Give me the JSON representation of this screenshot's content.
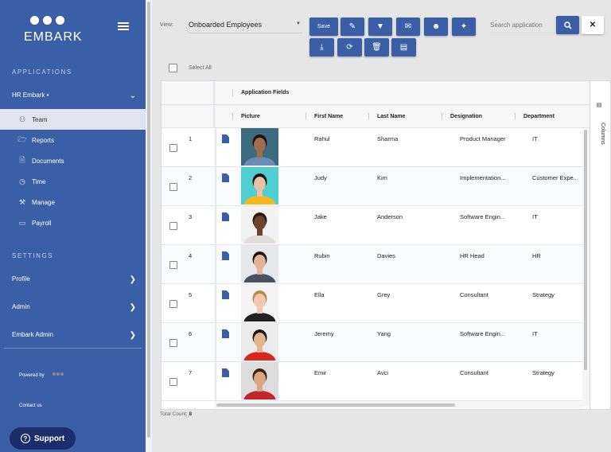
{
  "brand": {
    "name": "EMBARK",
    "menu_icon": "hamburger-icon"
  },
  "sidebar": {
    "applications_title": "APPLICATIONS",
    "app": {
      "label": "HR Embark •",
      "icon": "chevron-down-icon"
    },
    "items": [
      {
        "label": "Team",
        "icon": "team-icon",
        "active": true
      },
      {
        "label": "Reports",
        "icon": "folder-icon"
      },
      {
        "label": "Documents",
        "icon": "document-icon"
      },
      {
        "label": "Time",
        "icon": "clock-icon"
      },
      {
        "label": "Manage",
        "icon": "wrench-icon"
      },
      {
        "label": "Payroll",
        "icon": "card-icon"
      }
    ],
    "settings_title": "SETTINGS",
    "settings": [
      {
        "label": "Profile"
      },
      {
        "label": "Admin"
      },
      {
        "label": "Embark Admin"
      }
    ],
    "powered_by": "Powered by",
    "powered_logo": "EMBARK",
    "contact": "Contact us",
    "support": "Support"
  },
  "toolbar": {
    "view_label": "View:",
    "view_value": "Onboarded Employees",
    "save": "Save",
    "buttons_row1": [
      "edit-icon",
      "filter-icon",
      "email-icon",
      "group-icon",
      "magic-wand-icon"
    ],
    "buttons_row2": [
      "download-icon",
      "refresh-icon",
      "trash-icon",
      "archive-icon"
    ],
    "search_placeholder": "Search application",
    "select_all": "Select All"
  },
  "grid": {
    "group_header": "Application Fields",
    "columns": [
      "Picture",
      "First Name",
      "Last Name",
      "Designation",
      "Department"
    ],
    "columns_panel": "Columns",
    "rows": [
      {
        "n": "1",
        "first": "Rahul",
        "last": "Sharma",
        "designation": "Product Manager",
        "department": "IT",
        "bg": "#3e6a7e",
        "shirt": "#6a8bb5",
        "skin": "#a36d4d",
        "hair": "#1e1510"
      },
      {
        "n": "2",
        "first": "Judy",
        "last": "Kim",
        "designation": "Implementation...",
        "department": "Customer Expe...",
        "bg": "#4fcfd2",
        "shirt": "#f2b820",
        "skin": "#e8c2a3",
        "hair": "#1a1411"
      },
      {
        "n": "3",
        "first": "Jake",
        "last": "Anderson",
        "designation": "Software Engin...",
        "department": "IT",
        "bg": "#f2f2f2",
        "shirt": "#e2ddd6",
        "skin": "#6b442c",
        "hair": "#2a1a12"
      },
      {
        "n": "4",
        "first": "Rubin",
        "last": "Davies",
        "designation": "HR Head",
        "department": "HR",
        "bg": "#e6e8ec",
        "shirt": "#4a5160",
        "skin": "#e2b59a",
        "hair": "#231812"
      },
      {
        "n": "5",
        "first": "Ella",
        "last": "Grey",
        "designation": "Consultant",
        "department": "Strategy",
        "bg": "#f4f4f4",
        "shirt": "#222222",
        "skin": "#f0c9ae",
        "hair": "#b88a5a"
      },
      {
        "n": "6",
        "first": "Jeremy",
        "last": "Yang",
        "designation": "Software Engin...",
        "department": "IT",
        "bg": "#ececec",
        "shirt": "#d8261e",
        "skin": "#e2b491",
        "hair": "#1b1411"
      },
      {
        "n": "7",
        "first": "Emir",
        "last": "Avci",
        "designation": "Consultant",
        "department": "Strategy",
        "bg": "#dcdcdc",
        "shirt": "#c0262c",
        "skin": "#d9a582",
        "hair": "#3a2516"
      }
    ]
  },
  "footer": {
    "total_label": "Total Count:",
    "total_value": "8"
  },
  "colors": {
    "primary": "#3b5fa7",
    "support": "#1d2d6b"
  }
}
